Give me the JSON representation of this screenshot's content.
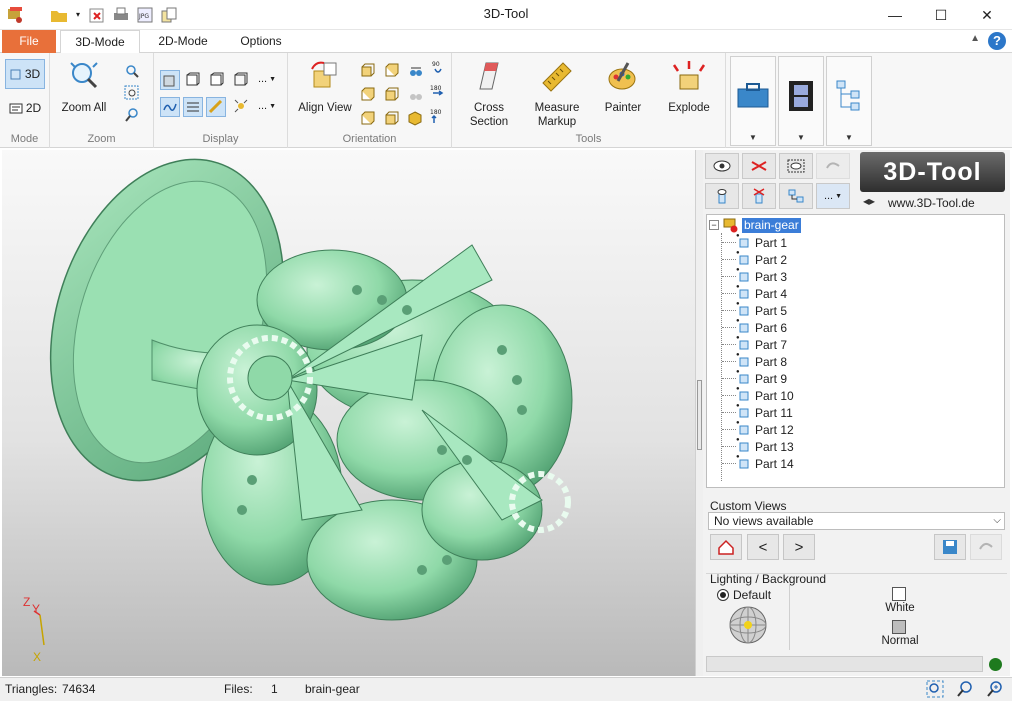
{
  "window": {
    "title": "3D-Tool",
    "minimize_glyph": "—",
    "maximize_glyph": "☐",
    "close_glyph": "✕"
  },
  "quick_access": [
    "app-icon",
    "open-icon",
    "dropdown-icon",
    "close-file-icon",
    "print-icon",
    "jpg-export-icon",
    "copy-icon"
  ],
  "tabs": [
    {
      "label": "File"
    },
    {
      "label": "3D-Mode"
    },
    {
      "label": "2D-Mode"
    },
    {
      "label": "Options"
    }
  ],
  "help_glyph": "?",
  "ribbon": {
    "mode": {
      "label": "Mode",
      "btn_3d": "3D",
      "btn_2d": "2D"
    },
    "zoom": {
      "label": "Zoom",
      "zoom_all": "Zoom All"
    },
    "display": {
      "label": "Display",
      "more": "..."
    },
    "orientation": {
      "label": "Orientation",
      "align_view": "Align View"
    },
    "tools": {
      "label": "Tools",
      "cross_section_1": "Cross",
      "cross_section_2": "Section",
      "measure_1": "Measure",
      "measure_2": "Markup",
      "painter": "Painter",
      "explode": "Explode"
    }
  },
  "axis": {
    "z": "Z",
    "y": "Y",
    "x": "X"
  },
  "panel": {
    "logo_text": "3D-Tool",
    "logo_url": "www.3D-Tool.de",
    "tree_root": "brain-gear",
    "parts": [
      "Part 1",
      "Part 2",
      "Part 3",
      "Part 4",
      "Part 5",
      "Part 6",
      "Part 7",
      "Part 8",
      "Part 9",
      "Part 10",
      "Part 11",
      "Part 12",
      "Part 13",
      "Part 14"
    ],
    "custom_views_label": "Custom Views",
    "custom_views_value": "No views available",
    "prev": "<",
    "next": ">",
    "lighting_label": "Lighting / Background",
    "default_label": "Default",
    "white_label": "White",
    "normal_label": "Normal"
  },
  "status": {
    "triangles_label": "Triangles:",
    "triangles_value": "74634",
    "files_label": "Files:",
    "files_value": "1",
    "file_name": "brain-gear"
  },
  "colors": {
    "accent_file_tab": "#e8703a",
    "model_green": "#8fd9a8",
    "selection_blue": "#3b7dd8",
    "status_ok": "#1e7a1e"
  }
}
